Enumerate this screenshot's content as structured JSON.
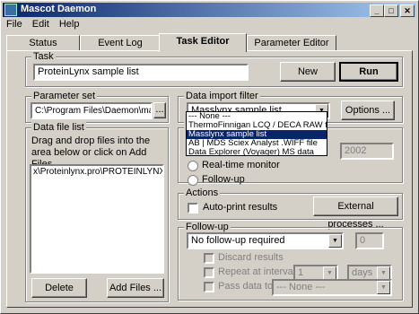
{
  "window": {
    "title": "Mascot Daemon"
  },
  "menu": [
    "File",
    "Edit",
    "Help"
  ],
  "tabs": [
    "Status",
    "Event Log",
    "Task Editor",
    "Parameter Editor"
  ],
  "task": {
    "group_label": "Task",
    "name_value": "ProteinLynx sample list",
    "new_label": "New",
    "run_label": "Run"
  },
  "parameter_set": {
    "group_label": "Parameter set",
    "value": "C:\\Program Files\\Daemon\\masslynx",
    "browse_label": "..."
  },
  "data_file_list": {
    "group_label": "Data file list",
    "instructions": "Drag and drop files into the area below or click on Add Files ...",
    "files": [
      "x\\Proteinlynx.pro\\PROTEINLYNX.SPL"
    ],
    "delete_label": "Delete",
    "add_files_label": "Add Files ..."
  },
  "import_filter": {
    "group_label": "Data import filter",
    "selected": "Masslynx sample list",
    "options_label": "Options ...",
    "options": [
      "--- None ---",
      "ThermoFinnigan LCQ / DECA RAW file",
      "Masslynx sample list",
      "AB | MDS Sciex Analyst .WIFF file",
      "Data Explorer (Voyager) MS data"
    ],
    "highlighted_index": 2
  },
  "schedule": {
    "group_label_partial": "S",
    "year_value": "2002",
    "realtime_label": "Real-time monitor",
    "followup_label": "Follow-up"
  },
  "actions": {
    "group_label": "Actions",
    "autoprint_label": "Auto-print results",
    "external_label": "External processes ..."
  },
  "followup": {
    "group_label": "Follow-up",
    "selected": "No follow-up required",
    "count_value": "0",
    "discard_label": "Discard results",
    "repeat_label": "Repeat at intervals of",
    "interval_value": "1",
    "interval_unit": "days",
    "pass_label": "Pass data to",
    "pass_value": "--- None ---"
  }
}
